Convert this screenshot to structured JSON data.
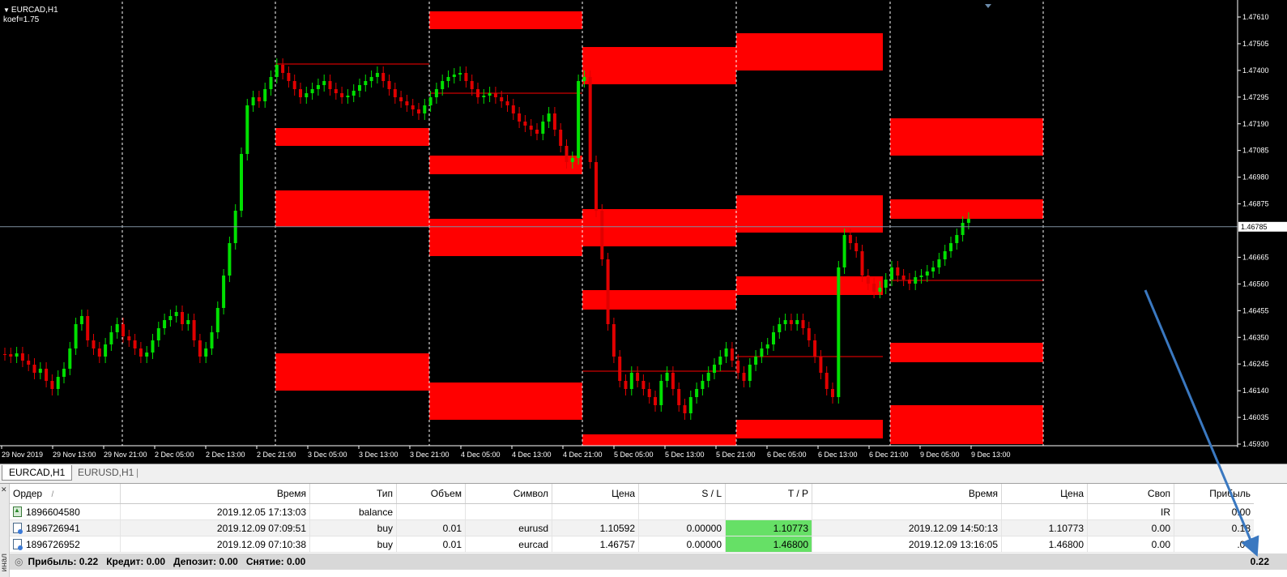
{
  "chart": {
    "symbol": "EURCAD,H1",
    "indicator_note": "koef=1.75",
    "current_price_label": "1.46785",
    "price_ticks": [
      "1.47610",
      "1.47505",
      "1.47400",
      "1.47295",
      "1.47190",
      "1.47085",
      "1.46980",
      "1.46875",
      "1.46665",
      "1.46560",
      "1.46455",
      "1.46350",
      "1.46245",
      "1.46140",
      "1.46035",
      "1.45930"
    ],
    "time_ticks": [
      "29 Nov 2019",
      "29 Nov 13:00",
      "29 Nov 21:00",
      "2 Dec 05:00",
      "2 Dec 13:00",
      "2 Dec 21:00",
      "3 Dec 05:00",
      "3 Dec 13:00",
      "3 Dec 21:00",
      "4 Dec 05:00",
      "4 Dec 13:00",
      "4 Dec 21:00",
      "5 Dec 05:00",
      "5 Dec 13:00",
      "5 Dec 21:00",
      "6 Dec 05:00",
      "6 Dec 13:00",
      "6 Dec 21:00",
      "9 Dec 05:00",
      "9 Dec 13:00"
    ],
    "colors": {
      "bull": "#00e000",
      "bear": "#e00000",
      "zone": "#ff0000",
      "background": "#000000",
      "grid": "#ffffff",
      "arrow": "#3a78c0"
    }
  },
  "tabs": [
    {
      "label": "EURCAD,H1",
      "active": true
    },
    {
      "label": "EURUSD,H1",
      "active": false
    }
  ],
  "terminal": {
    "side_label": "инал",
    "columns": [
      "Ордер",
      "Время",
      "Тип",
      "Объем",
      "Символ",
      "Цена",
      "S / L",
      "T / P",
      "Время",
      "Цена",
      "Своп",
      "Прибыль"
    ],
    "rows": [
      {
        "order": "1896604580",
        "open_time": "2019.12.05 17:13:03",
        "type": "balance",
        "volume": "",
        "symbol": "",
        "price": "",
        "sl": "",
        "tp": "",
        "close_time": "",
        "close_price": "",
        "swap": "IR",
        "profit": "0.00",
        "icon": "balance"
      },
      {
        "order": "1896726941",
        "open_time": "2019.12.09 07:09:51",
        "type": "buy",
        "volume": "0.01",
        "symbol": "eurusd",
        "price": "1.10592",
        "sl": "0.00000",
        "tp": "1.10773",
        "close_time": "2019.12.09 14:50:13",
        "close_price": "1.10773",
        "swap": "0.00",
        "profit": "0.18",
        "icon": "order"
      },
      {
        "order": "1896726952",
        "open_time": "2019.12.09 07:10:38",
        "type": "buy",
        "volume": "0.01",
        "symbol": "eurcad",
        "price": "1.46757",
        "sl": "0.00000",
        "tp": "1.46800",
        "close_time": "2019.12.09 13:16:05",
        "close_price": "1.46800",
        "swap": "0.00",
        "profit": ".04",
        "icon": "order"
      }
    ],
    "summary": {
      "profit": "Прибыль: 0.22",
      "credit": "Кредит: 0.00",
      "deposit": "Депозит: 0.00",
      "withdrawal": "Снятие: 0.00",
      "total": "0.22"
    }
  }
}
